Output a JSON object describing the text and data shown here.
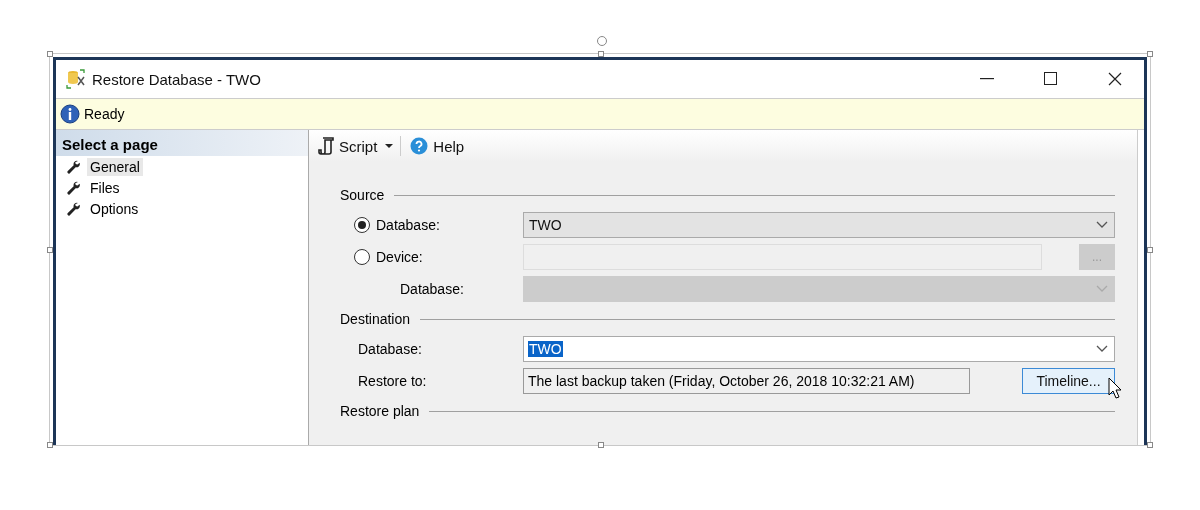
{
  "window": {
    "title": "Restore Database - TWO"
  },
  "status_bar": {
    "text": "Ready"
  },
  "sidebar": {
    "header": "Select a page",
    "items": [
      {
        "label": "General",
        "selected": true
      },
      {
        "label": "Files",
        "selected": false
      },
      {
        "label": "Options",
        "selected": false
      }
    ]
  },
  "toolbar": {
    "script": "Script",
    "help": "Help"
  },
  "sections": [
    {
      "title": "Source",
      "rows": [
        {
          "kind": "radio-combo",
          "label": "Database:",
          "selected": true,
          "value": "TWO"
        },
        {
          "kind": "radio-browse",
          "label": "Device:",
          "selected": false,
          "button": "..."
        },
        {
          "kind": "sub-combo",
          "label": "Database:",
          "disabled": true
        }
      ]
    },
    {
      "title": "Destination",
      "rows": [
        {
          "kind": "combo",
          "label": "Database:",
          "value": "TWO",
          "highlighted": true
        },
        {
          "kind": "text-button",
          "label": "Restore to:",
          "value": "The last backup taken (Friday, October 26, 2018 10:32:21 AM)",
          "button": "Timeline..."
        }
      ]
    },
    {
      "title": "Restore plan"
    }
  ]
}
